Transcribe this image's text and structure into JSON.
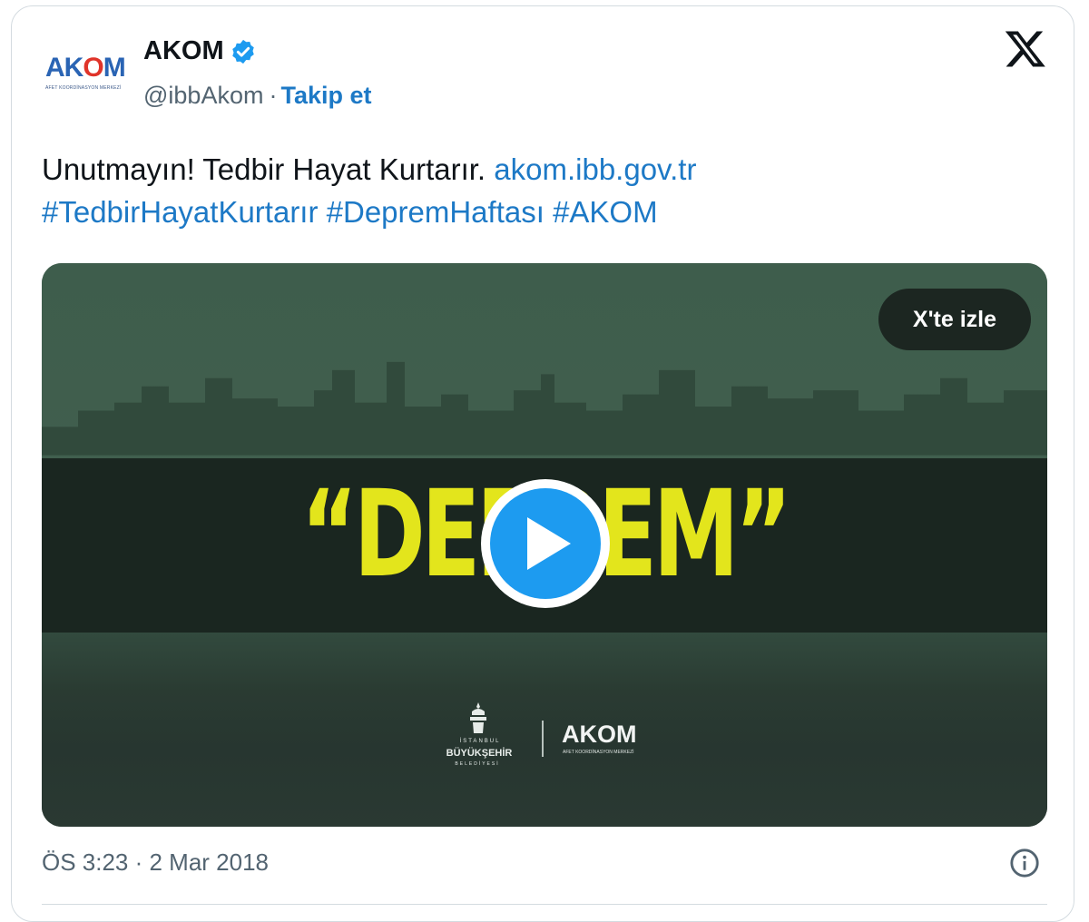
{
  "author": {
    "avatar_logo": "AKOM",
    "avatar_subtitle": "AFET KOORDİNASYON MERKEZİ",
    "name": "AKOM",
    "handle": "@ibbAkom",
    "separator": "·",
    "follow_label": "Takip et",
    "verified_icon": "verified-badge-icon"
  },
  "platform_icon": "x-logo-icon",
  "tweet": {
    "text": "Unutmayın! Tedbir Hayat Kurtarır.",
    "link": "akom.ibb.gov.tr",
    "hashtags": "#TedbirHayatKurtarır #DepremHaftası #AKOM"
  },
  "media": {
    "headline": "“DEPREM”",
    "watch_label": "X'te izle",
    "play_icon": "play-icon",
    "logo_ibb_line1": "İSTANBUL",
    "logo_ibb_line2": "BÜYÜKŞEHİR",
    "logo_ibb_line3": "BELEDİYESİ",
    "logo_akom": "AKOM",
    "logo_akom_sub": "AFET KOORDİNASYON MERKEZİ"
  },
  "footer": {
    "timestamp": "ÖS 3:23 · 2 Mar 2018",
    "info_icon": "info-icon"
  },
  "colors": {
    "link": "#1d79c6",
    "headline": "#e3e51c",
    "play_button": "#1d9bf0"
  }
}
